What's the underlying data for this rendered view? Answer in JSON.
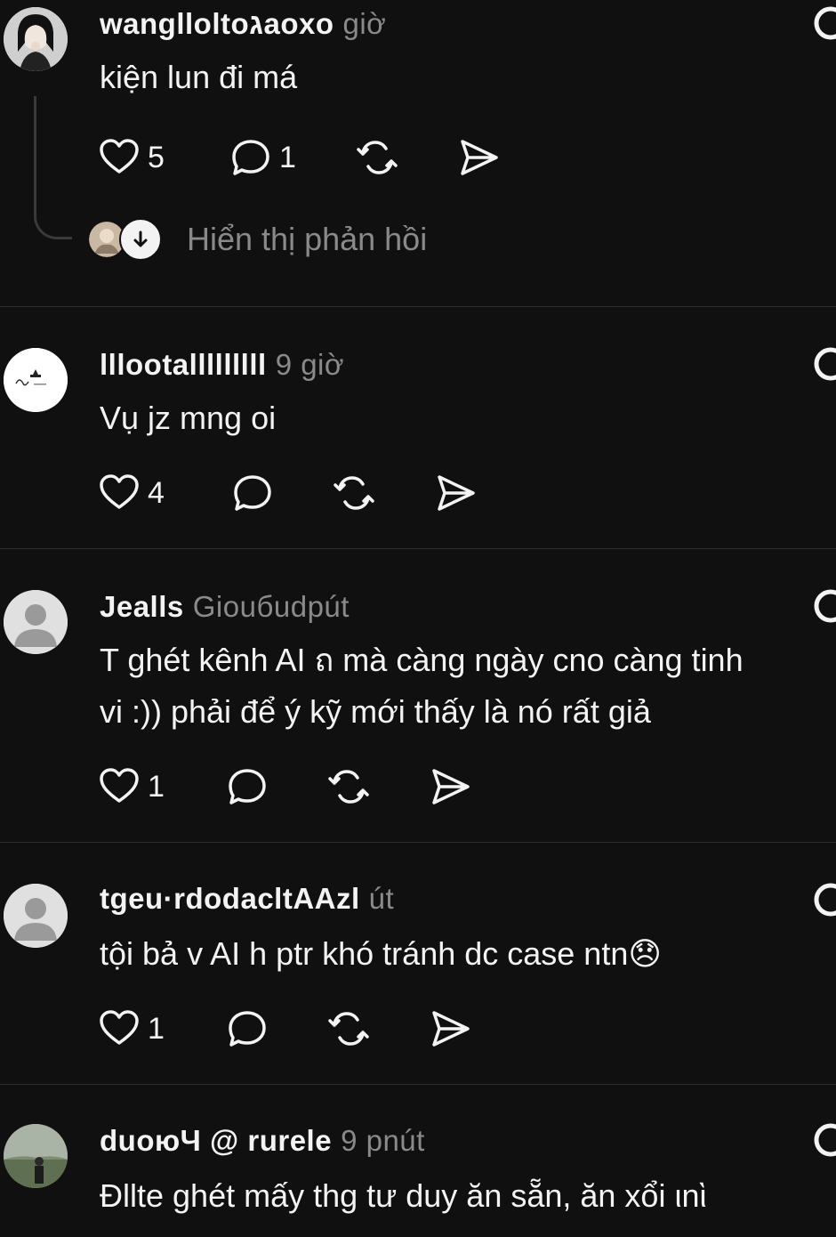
{
  "comments": [
    {
      "username": "wanglloltoגaoxo",
      "time": "giờ",
      "text": [
        "kiện lun đi má"
      ],
      "likes": "5",
      "replies": "1",
      "show_replies_label": "Hiển thị phản hồi"
    },
    {
      "username": "lllootalllllllll",
      "time": "9 giờ",
      "text": [
        "Vụ jz mng oi"
      ],
      "likes": "4",
      "replies": ""
    },
    {
      "username": "Jealls",
      "time": "Giouбudpút",
      "text": [
        "T ghét kênh AI ถ mà càng ngày cno càng tinh",
        "vi :)) phải để ý kỹ mới thấy là nó rất giả"
      ],
      "likes": "1",
      "replies": ""
    },
    {
      "username": "tgeu·rdodacltAAzl",
      "time": "út",
      "text": [
        "tội bả v AI h ptr khó tránh dc case ntn😞"
      ],
      "likes": "1",
      "replies": ""
    },
    {
      "username": "duoюЧ @ rurele",
      "time": "9 pnút",
      "text": [
        "Đllte ghét mấy thg tư duy ăn sẵn, ăn xổi ιnὶ"
      ],
      "likes": "",
      "replies": ""
    }
  ]
}
